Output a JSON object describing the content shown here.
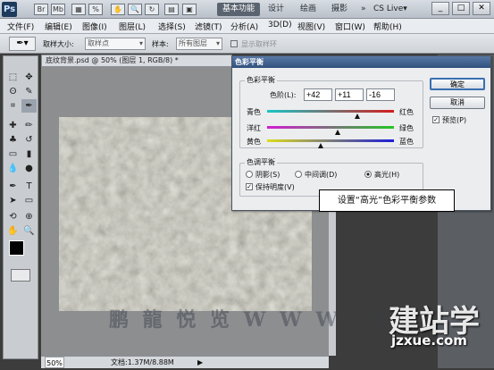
{
  "titlebar": {
    "app_logo": "Ps",
    "workspaces": [
      "基本功能",
      "设计",
      "绘画",
      "摄影"
    ],
    "more": "»",
    "cs_live": "CS Live▾",
    "window_buttons": [
      "_",
      "□",
      "✕"
    ]
  },
  "menu": [
    "文件(F)",
    "编辑(E)",
    "图像(I)",
    "图层(L)",
    "选择(S)",
    "滤镜(T)",
    "分析(A)",
    "3D(D)",
    "视图(V)",
    "窗口(W)",
    "帮助(H)"
  ],
  "options": {
    "sample_size_label": "取样大小:",
    "sample_size_value": "取样点",
    "sample_label": "样本:",
    "sample_value": "所有图层",
    "show_ring_label": "显示取样环"
  },
  "document": {
    "tab_title": "底纹背景.psd @ 50% (图层 1, RGB/8) *",
    "zoom": "50%",
    "doc_size": "文档:1.37M/8.88M"
  },
  "dialog": {
    "title": "色彩平衡",
    "color_balance_group": "色彩平衡",
    "levels_label": "色阶(L):",
    "levels": [
      "+42",
      "+11",
      "-16"
    ],
    "sliders": [
      {
        "left": "青色",
        "right": "红色",
        "value": 42
      },
      {
        "left": "洋红",
        "right": "绿色",
        "value": 11
      },
      {
        "left": "黄色",
        "right": "蓝色",
        "value": -16
      }
    ],
    "tone_group": "色调平衡",
    "tones": [
      "阴影(S)",
      "中间调(D)",
      "高光(H)"
    ],
    "selected_tone": "高光(H)",
    "preserve_luminosity": "保持明度(V)",
    "ok": "确定",
    "cancel": "取消",
    "preview": "预览(P)"
  },
  "callout": "设置“高光”色彩平衡参数",
  "watermarks": {
    "cn": "鹏 龍 悦 览 W W W . T I",
    "site": "建站学",
    "url": "jzxue.com"
  }
}
